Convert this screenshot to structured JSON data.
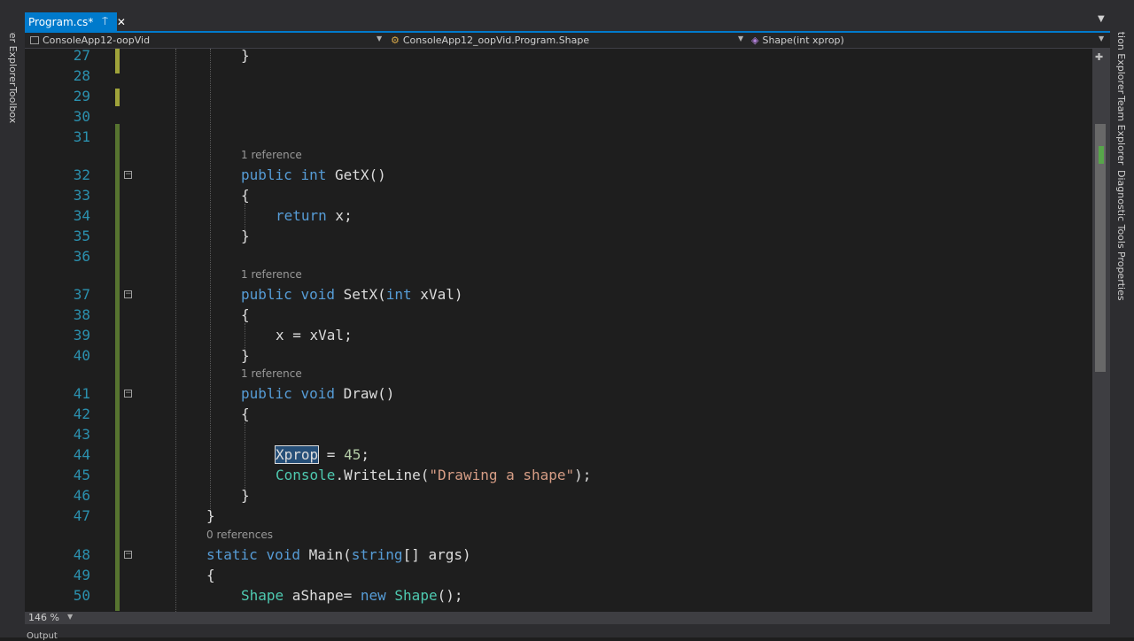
{
  "tabs": {
    "active_label": "Program.cs*",
    "pin": "⍑",
    "close": "✕"
  },
  "navbar": {
    "project": "ConsoleApp12-oopVid",
    "class": "ConsoleApp12_oopVid.Program.Shape",
    "member": "Shape(int xprop)"
  },
  "left_tools": [
    "Server Explorer",
    "Toolbox"
  ],
  "right_tools": [
    "Solution Explorer",
    "Team Explorer",
    "Diagnostic Tools",
    "Properties"
  ],
  "lens": {
    "getx": "1 reference",
    "setx": "1 reference",
    "draw": "1 reference",
    "main": "0 references"
  },
  "lines": {
    "n27": "27",
    "n28": "28",
    "n29": "29",
    "n30": "30",
    "n31": "31",
    "n32": "32",
    "n33": "33",
    "n34": "34",
    "n35": "35",
    "n36": "36",
    "n37": "37",
    "n38": "38",
    "n39": "39",
    "n40": "40",
    "n41": "41",
    "n42": "42",
    "n43": "43",
    "n44": "44",
    "n45": "45",
    "n46": "46",
    "n47": "47",
    "n48": "48",
    "n49": "49",
    "n50": "50"
  },
  "code": {
    "l27": "}",
    "l32_kw1": "public",
    "l32_kw2": "int",
    "l32_rest": " GetX()",
    "l33": "{",
    "l34_kw": "return",
    "l34_rest": " x;",
    "l35": "}",
    "l37_kw1": "public",
    "l37_kw2": "void",
    "l37_name": " SetX(",
    "l37_kw3": "int",
    "l37_rest": " xVal)",
    "l38": "{",
    "l39": "x = xVal;",
    "l40": "}",
    "l41_kw1": "public",
    "l41_kw2": "void",
    "l41_rest": " Draw()",
    "l42": "{",
    "l44_sel": "Xprop",
    "l44_mid": " = ",
    "l44_num": "45",
    "l44_end": ";",
    "l45_type": "Console",
    "l45_mid": ".WriteLine(",
    "l45_str": "\"Drawing a shape\"",
    "l45_end": ");",
    "l46": "}",
    "l47": "}",
    "l48_kw1": "static",
    "l48_kw2": "void",
    "l48_name": " Main(",
    "l48_kw3": "string",
    "l48_rest": "[] args)",
    "l49": "{",
    "l50_type1": "Shape",
    "l50_mid": " aShape= ",
    "l50_kw": "new",
    "l50_type2": " Shape",
    "l50_end": "();"
  },
  "status": {
    "zoom": "146 %",
    "output": "Output"
  },
  "colors": {
    "accent": "#007acc",
    "keyword": "#569cd6",
    "type": "#4ec9b0",
    "string": "#d69d85",
    "number": "#b5cea8",
    "line_number": "#2b91af",
    "change_saved": "#577430"
  }
}
